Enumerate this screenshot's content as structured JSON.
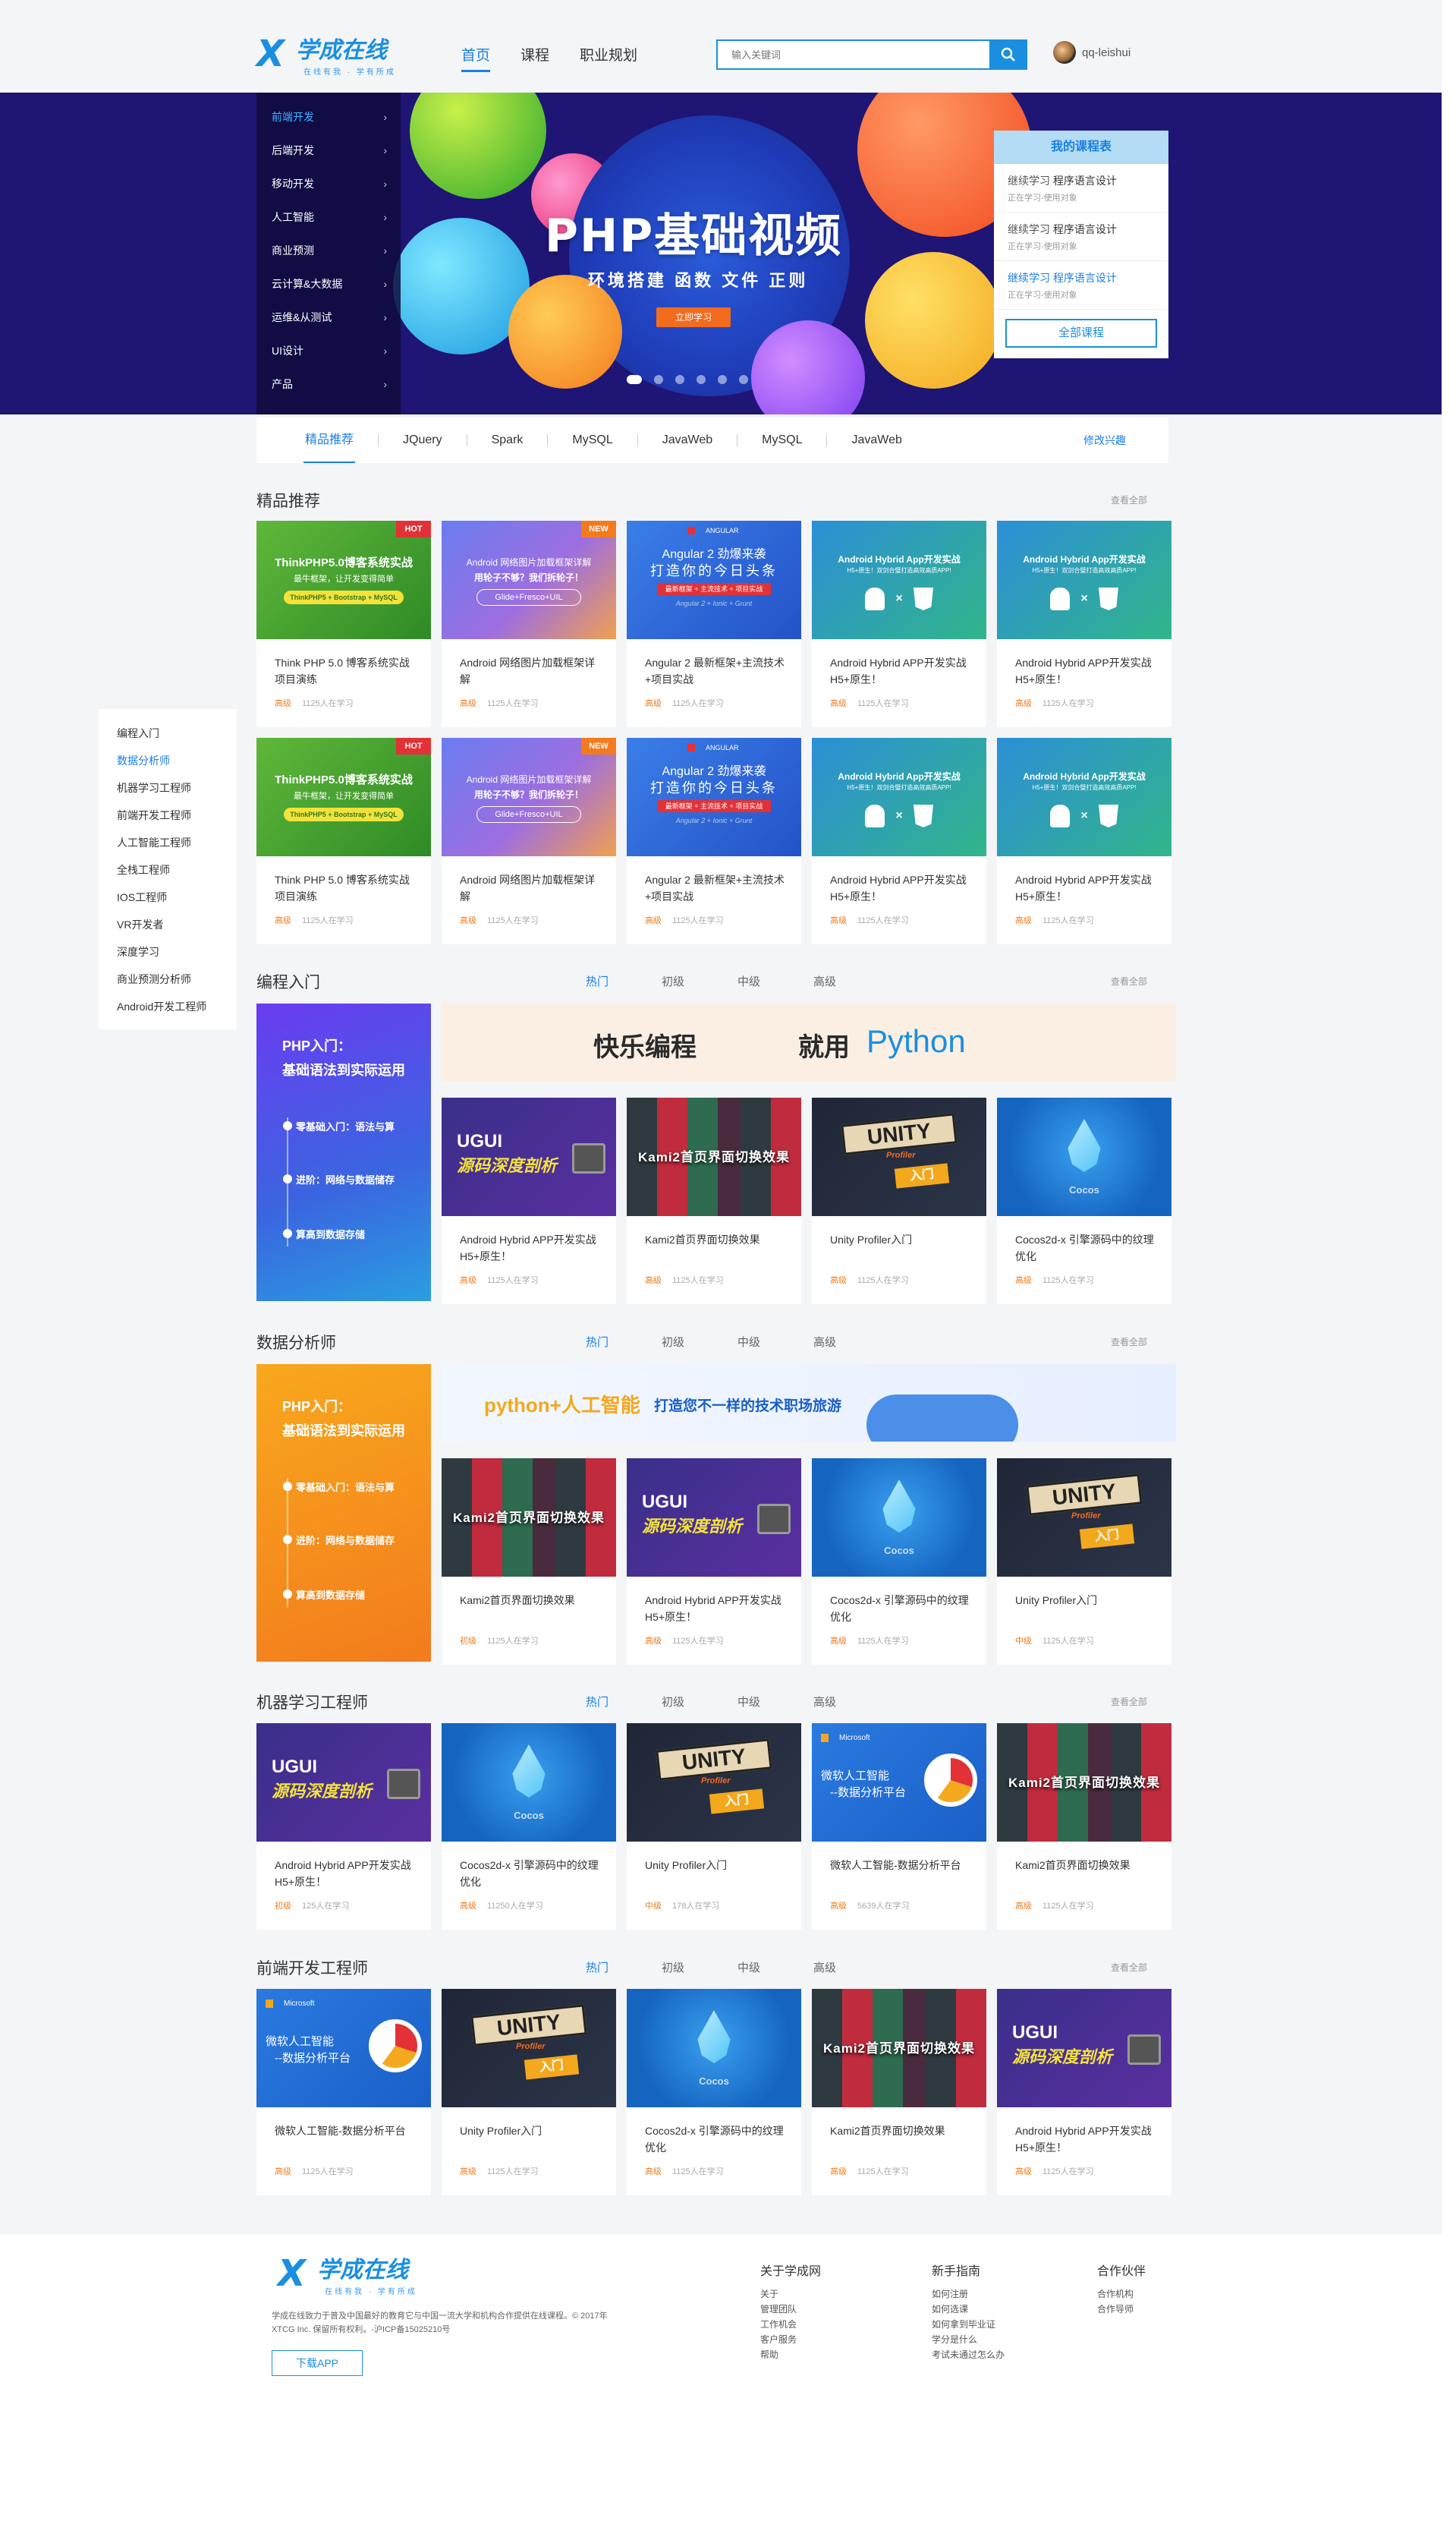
{
  "header": {
    "logo_mark": "X",
    "logo_name": "学成在线",
    "logo_slogan": "在线有我 · 学有所成",
    "nav": [
      "首页",
      "课程",
      "职业规划"
    ],
    "search_placeholder": "输入关键词",
    "username": "qq-leishui"
  },
  "banner": {
    "categories": [
      "前端开发",
      "后端开发",
      "移动开发",
      "人工智能",
      "商业预测",
      "云计算&大数据",
      "运维&从测试",
      "UI设计",
      "产品"
    ],
    "title": "PHP基础视频",
    "subtitle": "环境搭建  函数  文件  正则",
    "button": "立即学习",
    "my_courses": {
      "title": "我的课程表",
      "items": [
        {
          "a": "继续学习",
          "b": "程序语言设计",
          "c": "正在学习-使用对象"
        },
        {
          "a": "继续学习",
          "b": "程序语言设计",
          "c": "正在学习-使用对象"
        },
        {
          "a": "继续学习",
          "b": "程序语言设计",
          "c": "正在学习-使用对象"
        }
      ],
      "all": "全部课程"
    }
  },
  "tagbar": {
    "tags": [
      "精品推荐",
      "JQuery",
      "Spark",
      "MySQL",
      "JavaWeb",
      "MySQL",
      "JavaWeb"
    ],
    "edit": "修改兴趣"
  },
  "side_menu": [
    "编程入门",
    "数据分析师",
    "机器学习工程师",
    "前端开发工程师",
    "人工智能工程师",
    "全栈工程师",
    "IOS工程师",
    "VR开发者",
    "深度学习",
    "商业预测分析师",
    "Android开发工程师"
  ],
  "common": {
    "more": "查看全部",
    "level_tabs": [
      "热门",
      "初级",
      "中级",
      "高级"
    ]
  },
  "thumbs": {
    "tp_title": "ThinkPHP5.0博客系统实战",
    "tp_sub": "最牛框架，让开发变得简单",
    "tp_tag": "ThinkPHP5 + Bootstrap + MySQL",
    "and_title": "Android 网络图片加载框架详解",
    "and_sub": "用轮子不够？我们拆轮子！",
    "and_tag": "Glide+Fresco+UIL",
    "ng_logo": "ANGULAR",
    "ng_title": "Angular 2 劲爆来袭",
    "ng_title2": "打造你的今日头条",
    "ng_tag": "最新框架 + 主流技术 + 项目实战",
    "ng_sub": "Angular 2 + Ionic + Grunt",
    "hy_title": "Android Hybrid App开发实战",
    "hy_sub": "H5+原生！双剑合璧打造高效高质APP!",
    "ugui1": "UGUI",
    "ugui2": "源码深度剖析",
    "kami": "Kami2首页界面切换效果",
    "unity": "UNITY",
    "unity_sub": "Profiler",
    "unity_in": "入门",
    "cocos": "Cocos",
    "ms": "Microsoft",
    "ms_title": "微软人工智能",
    "ms_sub": "--数据分析平台",
    "python_banner_a": "快乐编程",
    "python_banner_b": "就用",
    "python_banner_c": "Python",
    "ai_banner_a": "python+人工智能",
    "ai_banner_b": "打造您不一样的技术职场旅游",
    "php_big_title": "PHP入门：",
    "php_big_title2": "基础语法到实际运用",
    "php_big_l1": "零基础入门：语法与算",
    "php_big_l2": "进阶：网络与数据储存",
    "php_big_l3": "算高到数据存储"
  },
  "sec1": {
    "title": "精品推荐",
    "cards": [
      {
        "t": "Think PHP 5.0 博客系统实战项目演练",
        "lv": "高级",
        "n": "1125人在学习",
        "badge": "HOT"
      },
      {
        "t": "Android 网络图片加载框架详解",
        "lv": "高级",
        "n": "1125人在学习",
        "badge": "NEW"
      },
      {
        "t": "Angular 2 最新框架+主流技术+项目实战",
        "lv": "高级",
        "n": "1125人在学习"
      },
      {
        "t": "Android Hybrid APP开发实战 H5+原生！",
        "lv": "高级",
        "n": "1125人在学习"
      },
      {
        "t": "Android Hybrid APP开发实战 H5+原生！",
        "lv": "高级",
        "n": "1125人在学习"
      },
      {
        "t": "Think PHP 5.0 博客系统实战项目演练",
        "lv": "高级",
        "n": "1125人在学习",
        "badge": "HOT"
      },
      {
        "t": "Android 网络图片加载框架详解",
        "lv": "高级",
        "n": "1125人在学习",
        "badge": "NEW"
      },
      {
        "t": "Angular 2 最新框架+主流技术+项目实战",
        "lv": "高级",
        "n": "1125人在学习"
      },
      {
        "t": "Android Hybrid APP开发实战 H5+原生！",
        "lv": "高级",
        "n": "1125人在学习"
      },
      {
        "t": "Android Hybrid APP开发实战 H5+原生！",
        "lv": "高级",
        "n": "1125人在学习"
      }
    ]
  },
  "sec2": {
    "title": "编程入门",
    "cards": [
      {
        "t": "Android Hybrid APP开发实战 H5+原生！",
        "lv": "高级",
        "n": "1125人在学习"
      },
      {
        "t": "Kami2首页界面切换效果",
        "lv": "高级",
        "n": "1125人在学习"
      },
      {
        "t": "Unity Profiler入门",
        "lv": "高级",
        "n": "1125人在学习"
      },
      {
        "t": "Cocos2d-x  引擎源码中的纹理优化",
        "lv": "高级",
        "n": "1125人在学习"
      }
    ]
  },
  "sec3": {
    "title": "数据分析师",
    "cards": [
      {
        "t": "Kami2首页界面切换效果",
        "lv": "初级",
        "n": "1125人在学习"
      },
      {
        "t": "Android Hybrid APP开发实战 H5+原生！",
        "lv": "高级",
        "n": "1125人在学习"
      },
      {
        "t": "Cocos2d-x  引擎源码中的纹理优化",
        "lv": "高级",
        "n": "1125人在学习"
      },
      {
        "t": "Unity Profiler入门",
        "lv": "中级",
        "n": "1125人在学习"
      }
    ]
  },
  "sec4": {
    "title": "机器学习工程师",
    "cards": [
      {
        "t": "Android Hybrid APP开发实战 H5+原生！",
        "lv": "初级",
        "n": "125人在学习"
      },
      {
        "t": "Cocos2d-x  引擎源码中的纹理优化",
        "lv": "高级",
        "n": "11250人在学习"
      },
      {
        "t": "Unity Profiler入门",
        "lv": "中级",
        "n": "178人在学习"
      },
      {
        "t": "微软人工智能-数据分析平台",
        "lv": "高级",
        "n": "5639人在学习"
      },
      {
        "t": "Kami2首页界面切换效果",
        "lv": "高级",
        "n": "1125人在学习"
      }
    ]
  },
  "sec5": {
    "title": "前端开发工程师",
    "cards": [
      {
        "t": "微软人工智能-数据分析平台",
        "lv": "高级",
        "n": "1125人在学习"
      },
      {
        "t": "Unity Profiler入门",
        "lv": "高级",
        "n": "1125人在学习"
      },
      {
        "t": "Cocos2d-x  引擎源码中的纹理优化",
        "lv": "高级",
        "n": "1125人在学习"
      },
      {
        "t": "Kami2首页界面切换效果",
        "lv": "高级",
        "n": "1125人在学习"
      },
      {
        "t": "Android Hybrid APP开发实战 H5+原生！",
        "lv": "高级",
        "n": "1125人在学习"
      }
    ]
  },
  "footer": {
    "desc": "学成在线致力于普及中国最好的教育它与中国一流大学和机构合作提供在线课程。© 2017年XTCG Inc. 保留所有权利。-沪ICP备15025210号",
    "download": "下载APP",
    "col1": {
      "title": "关于学成网",
      "links": [
        "关于",
        "管理团队",
        "工作机会",
        "客户服务",
        "帮助"
      ]
    },
    "col2": {
      "title": "新手指南",
      "links": [
        "如何注册",
        "如何选课",
        "如何拿到毕业证",
        "学分是什么",
        "考试未通过怎么办"
      ]
    },
    "col3": {
      "title": "合作伙伴",
      "links": [
        "合作机构",
        "合作导师"
      ]
    }
  },
  "colors": {
    "brand": "#1a8fe0",
    "accent": "#f37b1d",
    "banner_bg": "#1e1575"
  }
}
